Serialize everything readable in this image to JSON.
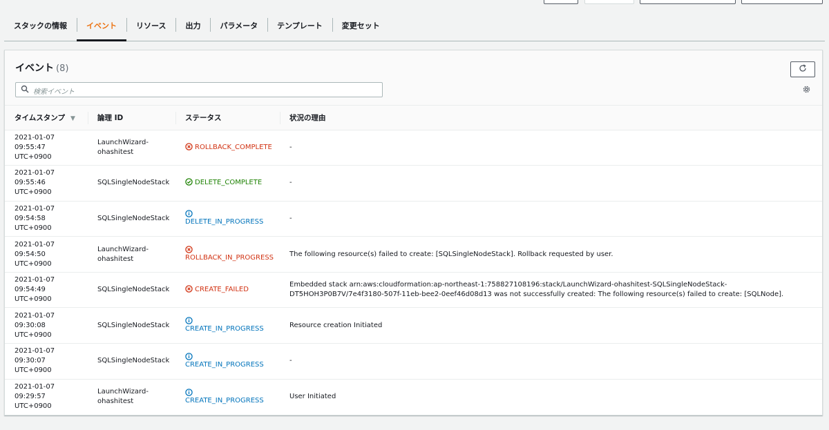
{
  "tabs": [
    {
      "label": "スタックの情報",
      "active": false
    },
    {
      "label": "イベント",
      "active": true
    },
    {
      "label": "リソース",
      "active": false
    },
    {
      "label": "出力",
      "active": false
    },
    {
      "label": "パラメータ",
      "active": false
    },
    {
      "label": "テンプレート",
      "active": false
    },
    {
      "label": "変更セット",
      "active": false
    }
  ],
  "panel": {
    "title": "イベント",
    "count": "(8)",
    "search_placeholder": "検索イベント"
  },
  "table": {
    "columns": [
      "タイムスタンプ",
      "論理 ID",
      "ステータス",
      "状況の理由"
    ],
    "rows": [
      {
        "timestamp": "2021-01-07\n09:55:47\nUTC+0900",
        "logical_id": "LaunchWizard-\nohashitest",
        "status": "ROLLBACK_COMPLETE",
        "status_kind": "error",
        "stacked": false,
        "reason": "-"
      },
      {
        "timestamp": "2021-01-07\n09:55:46\nUTC+0900",
        "logical_id": "SQLSingleNodeStack",
        "status": "DELETE_COMPLETE",
        "status_kind": "success",
        "stacked": false,
        "reason": "-"
      },
      {
        "timestamp": "2021-01-07\n09:54:58\nUTC+0900",
        "logical_id": "SQLSingleNodeStack",
        "status": "DELETE_IN_PROGRESS",
        "status_kind": "info",
        "stacked": true,
        "reason": "-"
      },
      {
        "timestamp": "2021-01-07\n09:54:50\nUTC+0900",
        "logical_id": "LaunchWizard-\nohashitest",
        "status": "ROLLBACK_IN_PROGRESS",
        "status_kind": "error",
        "stacked": true,
        "reason": "The following resource(s) failed to create: [SQLSingleNodeStack]. Rollback requested by user."
      },
      {
        "timestamp": "2021-01-07\n09:54:49\nUTC+0900",
        "logical_id": "SQLSingleNodeStack",
        "status": "CREATE_FAILED",
        "status_kind": "error",
        "stacked": false,
        "reason": "Embedded stack arn:aws:cloudformation:ap-northeast-1:758827108196:stack/LaunchWizard-ohashitest-SQLSingleNodeStack-DT5HOH3P0B7V/7e4f3180-507f-11eb-bee2-0eef46d08d13 was not successfully created: The following resource(s) failed to create: [SQLNode]."
      },
      {
        "timestamp": "2021-01-07\n09:30:08\nUTC+0900",
        "logical_id": "SQLSingleNodeStack",
        "status": "CREATE_IN_PROGRESS",
        "status_kind": "info",
        "stacked": true,
        "reason": "Resource creation Initiated"
      },
      {
        "timestamp": "2021-01-07\n09:30:07\nUTC+0900",
        "logical_id": "SQLSingleNodeStack",
        "status": "CREATE_IN_PROGRESS",
        "status_kind": "info",
        "stacked": true,
        "reason": "-"
      },
      {
        "timestamp": "2021-01-07\n09:29:57\nUTC+0900",
        "logical_id": "LaunchWizard-\nohashitest",
        "status": "CREATE_IN_PROGRESS",
        "status_kind": "info",
        "stacked": true,
        "reason": "User Initiated"
      }
    ]
  },
  "colors": {
    "error": "#d13212",
    "success": "#1d8102",
    "info": "#0073bb",
    "active_tab": "#ec7211"
  },
  "icons": {
    "error": "error-circle-x-icon",
    "success": "success-circle-check-icon",
    "info": "info-circle-icon"
  }
}
